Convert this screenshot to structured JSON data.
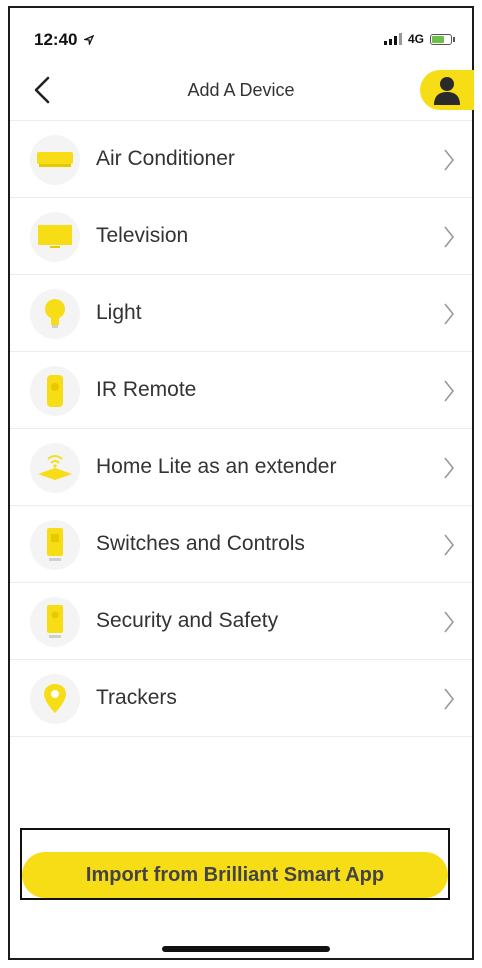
{
  "status_bar": {
    "time": "12:40",
    "network": "4G",
    "icons": [
      "location-arrow-icon",
      "signal-bars-icon",
      "battery-charging-icon"
    ]
  },
  "nav": {
    "title": "Add A Device",
    "back_icon": "chevron-left-icon",
    "profile_icon": "user-avatar-icon"
  },
  "devices": [
    {
      "label": "Air Conditioner",
      "icon": "air-conditioner-icon"
    },
    {
      "label": "Television",
      "icon": "television-icon"
    },
    {
      "label": "Light",
      "icon": "light-bulb-icon"
    },
    {
      "label": "IR Remote",
      "icon": "remote-icon"
    },
    {
      "label": "Home Lite as an extender",
      "icon": "wifi-extender-icon"
    },
    {
      "label": "Switches and Controls",
      "icon": "switch-icon"
    },
    {
      "label": "Security and Safety",
      "icon": "security-camera-icon"
    },
    {
      "label": "Trackers",
      "icon": "location-pin-icon"
    }
  ],
  "import_button": {
    "label": "Import from Brilliant Smart App"
  },
  "colors": {
    "accent": "#f7dd16",
    "text": "#333333",
    "divider": "#ececec"
  }
}
